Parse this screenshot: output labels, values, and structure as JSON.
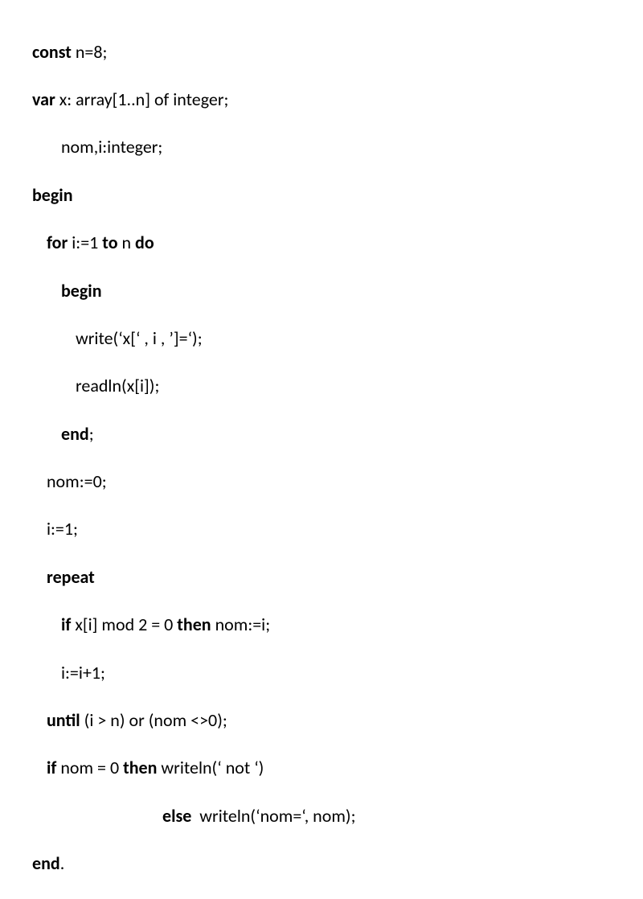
{
  "code": {
    "l1_kw": "const",
    "l1_rest": " n=8;",
    "l2_kw": "var",
    "l2_rest": " x: array[1..n] of integer;",
    "l3": "nom,i:integer;",
    "l4_kw": "begin",
    "l5_kw1": "for",
    "l5_mid": " i:=1 ",
    "l5_kw2": "to",
    "l5_mid2": " n ",
    "l5_kw3": "do",
    "l6_kw": "begin",
    "l7": "write(‘x[‘ , i , ’]=‘);",
    "l8": "readln(x[i]);",
    "l9_kw": "end",
    "l9_rest": ";",
    "l10": "nom:=0;",
    "l11": "i:=1;",
    "l12_kw": "repeat",
    "l13_kw1": "if",
    "l13_mid": " x[i] mod 2 = 0 ",
    "l13_kw2": "then",
    "l13_rest": " nom:=i;",
    "l14": "i:=i+1;",
    "l15_kw": "until",
    "l15_rest": " (i > n) or (nom <>0);",
    "l16_kw1": "if",
    "l16_mid": " nom = 0 ",
    "l16_kw2": "then",
    "l16_rest": " writeln(‘ not ‘)",
    "l17_kw": "else",
    "l17_rest": "  writeln(‘nom=‘, nom);",
    "l18_kw": "end",
    "l18_rest": "."
  }
}
